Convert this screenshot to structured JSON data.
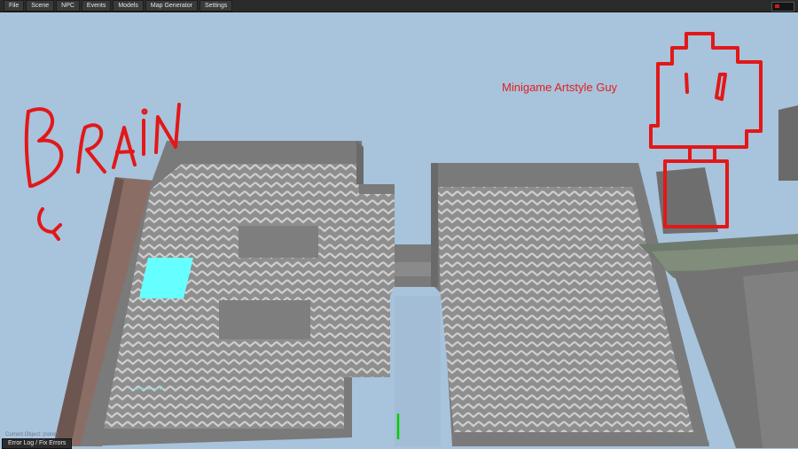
{
  "menu": {
    "items": [
      {
        "label": "File"
      },
      {
        "label": "Scene"
      },
      {
        "label": "NPC"
      },
      {
        "label": "Events"
      },
      {
        "label": "Models"
      },
      {
        "label": "Map Generator"
      },
      {
        "label": "Settings"
      }
    ]
  },
  "annotations": {
    "brain_text": "BRAIN",
    "artstyle_label": "Minigame Artstyle Guy"
  },
  "status": {
    "current_object": "Current Object: (none)",
    "object_count": "Object Count: 356",
    "error_button": "Error Log / Fix Errors"
  },
  "colors": {
    "sky": "#a8c3dc",
    "wall": "#7a7a7a",
    "floor_pattern": "#9c9c9c",
    "annotation": "#e02020",
    "selection": "#66ffff",
    "gizmo": "#00d000"
  }
}
